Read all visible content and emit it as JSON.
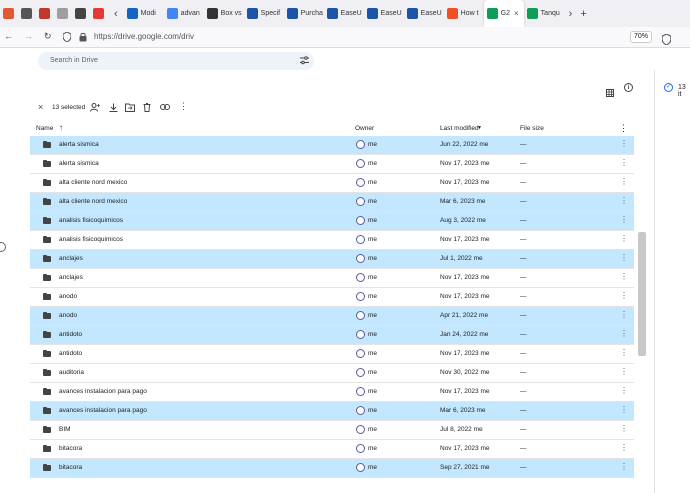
{
  "browser": {
    "tabs": [
      {
        "label": "",
        "color": "#e15a2f",
        "icon": "app-icon"
      },
      {
        "label": "",
        "color": "#555555",
        "icon": "avatar-icon"
      },
      {
        "label": "",
        "color": "#c0382b",
        "icon": "bookmark-icon"
      },
      {
        "label": "",
        "color": "#9e9e9e",
        "icon": "ps-icon"
      },
      {
        "label": "",
        "color": "#444444",
        "icon": "window-icon"
      },
      {
        "label": "",
        "color": "#e53935",
        "icon": "book-icon"
      },
      {
        "label": "Modi",
        "color": "#1565c0",
        "icon": "sw-icon"
      },
      {
        "label": "advan",
        "color": "#4285f4",
        "icon": "google-icon"
      },
      {
        "label": "Box vs",
        "color": "#333333",
        "icon": "box-icon"
      },
      {
        "label": "Specif",
        "color": "#1a53a8",
        "icon": "easeus-icon"
      },
      {
        "label": "Purcha",
        "color": "#1a53a8",
        "icon": "easeus-icon"
      },
      {
        "label": "EaseU",
        "color": "#1a53a8",
        "icon": "easeus-icon"
      },
      {
        "label": "EaseU",
        "color": "#1a53a8",
        "icon": "easeus-icon"
      },
      {
        "label": "EaseU",
        "color": "#1a53a8",
        "icon": "easeus-icon"
      },
      {
        "label": "How t",
        "color": "#f25022",
        "icon": "microsoft-icon"
      },
      {
        "label": "G2",
        "color": "#0f9d58",
        "icon": "drive-icon"
      },
      {
        "label": "Tanqu",
        "color": "#0f9d58",
        "icon": "drive-icon"
      }
    ],
    "url": "https://drive.google.com/driv",
    "zoom": "70%"
  },
  "search": {
    "placeholder": "Search in Drive"
  },
  "side_panel": {
    "text": "13 it"
  },
  "toolbar": {
    "selected_label": "13 selected"
  },
  "columns": {
    "name": "Name",
    "owner": "Owner",
    "modified": "Last modified",
    "size": "File size"
  },
  "rows": [
    {
      "name": "alerta sismica",
      "owner": "me",
      "modified": "Jun 22, 2022 me",
      "size": "—",
      "selected": true
    },
    {
      "name": "alerta sismica",
      "owner": "me",
      "modified": "Nov 17, 2023 me",
      "size": "—",
      "selected": false
    },
    {
      "name": "alta cliente nord mexico",
      "owner": "me",
      "modified": "Nov 17, 2023 me",
      "size": "—",
      "selected": false
    },
    {
      "name": "alta cliente nord mexico",
      "owner": "me",
      "modified": "Mar 6, 2023 me",
      "size": "—",
      "selected": true
    },
    {
      "name": "analisis fisicoquimicos",
      "owner": "me",
      "modified": "Aug 3, 2022 me",
      "size": "—",
      "selected": true
    },
    {
      "name": "analisis fisicoquimicos",
      "owner": "me",
      "modified": "Nov 17, 2023 me",
      "size": "—",
      "selected": false
    },
    {
      "name": "anclajes",
      "owner": "me",
      "modified": "Jul 1, 2022 me",
      "size": "—",
      "selected": true
    },
    {
      "name": "anclajes",
      "owner": "me",
      "modified": "Nov 17, 2023 me",
      "size": "—",
      "selected": false
    },
    {
      "name": "anodo",
      "owner": "me",
      "modified": "Nov 17, 2023 me",
      "size": "—",
      "selected": false
    },
    {
      "name": "anodo",
      "owner": "me",
      "modified": "Apr 21, 2022 me",
      "size": "—",
      "selected": true
    },
    {
      "name": "antidoto",
      "owner": "me",
      "modified": "Jan 24, 2022 me",
      "size": "—",
      "selected": true
    },
    {
      "name": "antidoto",
      "owner": "me",
      "modified": "Nov 17, 2023 me",
      "size": "—",
      "selected": false
    },
    {
      "name": "auditoria",
      "owner": "me",
      "modified": "Nov 30, 2022 me",
      "size": "—",
      "selected": false
    },
    {
      "name": "avances instalacion para pago",
      "owner": "me",
      "modified": "Nov 17, 2023 me",
      "size": "—",
      "selected": false
    },
    {
      "name": "avances instalacion para pago",
      "owner": "me",
      "modified": "Mar 6, 2023 me",
      "size": "—",
      "selected": true
    },
    {
      "name": "BIM",
      "owner": "me",
      "modified": "Jul 8, 2022 me",
      "size": "—",
      "selected": false
    },
    {
      "name": "bitacora",
      "owner": "me",
      "modified": "Nov 17, 2023 me",
      "size": "—",
      "selected": false
    },
    {
      "name": "bitacora",
      "owner": "me",
      "modified": "Sep 27, 2021 me",
      "size": "—",
      "selected": true
    }
  ],
  "colors": {
    "selected_row": "#c2e7ff",
    "accent": "#1a73e8"
  }
}
